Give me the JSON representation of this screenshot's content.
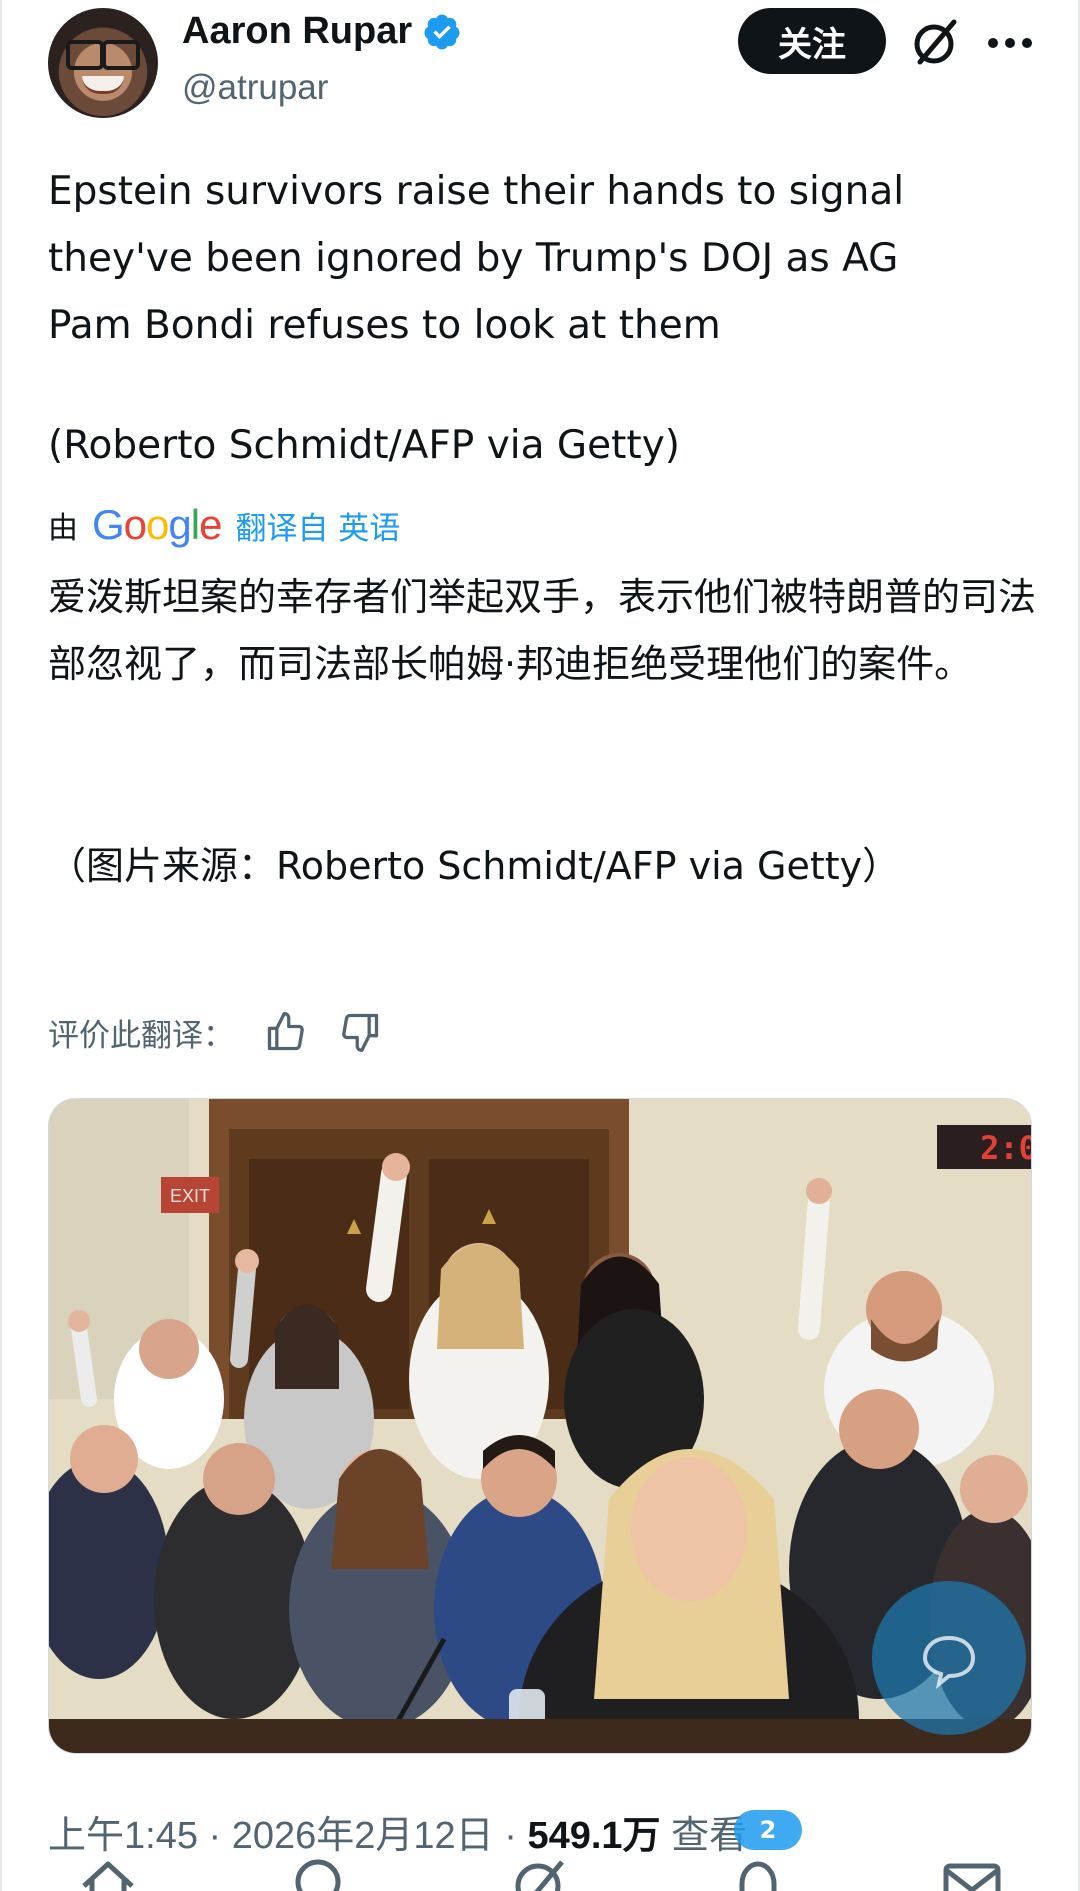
{
  "author": {
    "name": "Aaron Rupar",
    "handle": "@atrupar",
    "verified": true
  },
  "actions": {
    "follow_label": "关注",
    "grok_icon": "grok-slash-icon",
    "more_icon": "more-dots-icon"
  },
  "tweet": {
    "text": "Epstein survivors raise their hands to signal they've been ignored by Trump's DOJ as AG Pam Bondi refuses to look at them",
    "credit": "(Roberto Schmidt/AFP via Getty)"
  },
  "translation": {
    "by_label": "由",
    "provider_logo": "Google",
    "from_label": "翻译自 英语",
    "text": "爱泼斯坦案的幸存者们举起双手，表示他们被特朗普的司法部忽视了，而司法部长帕姆·邦迪拒绝受理他们的案件。",
    "credit": "（图片来源：Roberto Schmidt/AFP via Getty）",
    "rate_label": "评价此翻译：",
    "thumbs_up_icon": "thumbs-up-icon",
    "thumbs_down_icon": "thumbs-down-icon"
  },
  "photo": {
    "clock_text": "2:0",
    "exit_sign": "EXIT"
  },
  "meta": {
    "time": "上午1:45 · 2026年2月12日 · ",
    "views_count": "549.1万",
    "views_label": " 查看"
  },
  "bottom_nav": {
    "items": [
      "home-icon",
      "search-icon",
      "grok-icon",
      "notifications-icon",
      "messages-icon"
    ],
    "notification_badge": "2"
  },
  "colors": {
    "accent": "#1d9bf0",
    "text_primary": "#0f1419",
    "text_secondary": "#536471",
    "follow_bg": "#0f1419"
  }
}
